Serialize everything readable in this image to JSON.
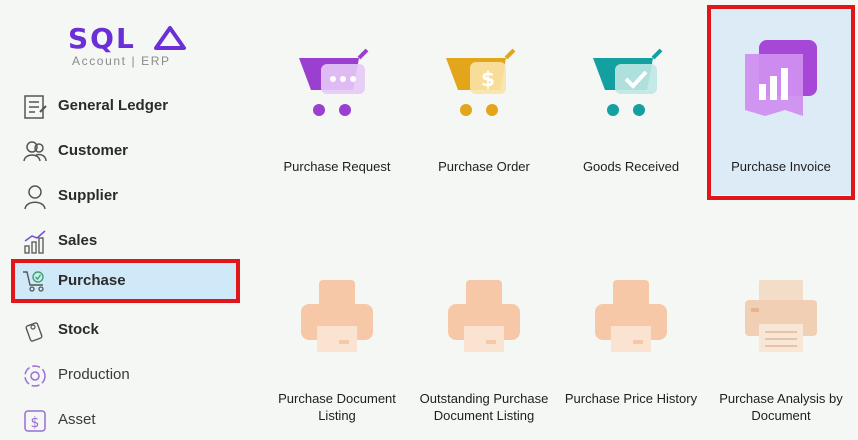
{
  "brand": {
    "name": "SQL",
    "subtitle": "Account | ERP",
    "color": "#6a2fd6"
  },
  "sidebar": {
    "items": [
      {
        "label": "General Ledger",
        "icon": "ledger-icon"
      },
      {
        "label": "Customer",
        "icon": "customer-icon"
      },
      {
        "label": "Supplier",
        "icon": "supplier-icon"
      },
      {
        "label": "Sales",
        "icon": "sales-chart-icon"
      },
      {
        "label": "Purchase",
        "icon": "purchase-cart-icon",
        "active": true
      },
      {
        "label": "Stock",
        "icon": "stock-icon"
      },
      {
        "label": "Production",
        "icon": "production-icon"
      },
      {
        "label": "Asset",
        "icon": "asset-icon"
      }
    ]
  },
  "tiles": {
    "row1": [
      {
        "label": "Purchase Request",
        "icon": "purchase-request-cart-icon",
        "color": "#9b3fd0"
      },
      {
        "label": "Purchase Order",
        "icon": "purchase-order-cart-icon",
        "color": "#e3a51a"
      },
      {
        "label": "Goods Received",
        "icon": "goods-received-cart-icon",
        "color": "#149fa0"
      },
      {
        "label": "Purchase Invoice",
        "icon": "purchase-invoice-chart-icon",
        "color": "#a647d8",
        "selected": true
      }
    ],
    "row2": [
      {
        "label": "Purchase Document Listing",
        "line1": "Purchase Document",
        "line2": "Listing",
        "icon": "printer-icon"
      },
      {
        "label": "Outstanding Purchase Document Listing",
        "line1": "Outstanding Purchase",
        "line2": "Document Listing",
        "icon": "printer-icon"
      },
      {
        "label": "Purchase Price History",
        "line1": "Purchase Price History",
        "line2": "",
        "icon": "printer-icon"
      },
      {
        "label": "Purchase Analysis by Document",
        "line1": "Purchase Analysis by",
        "line2": "Document",
        "icon": "printer-icon"
      }
    ]
  },
  "colors": {
    "highlight": "#e0161b",
    "active_bg": "#cfe9f8",
    "printer": "#f6c8a8"
  }
}
